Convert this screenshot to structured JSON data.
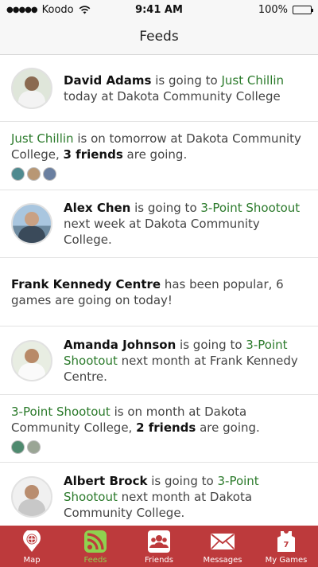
{
  "status": {
    "carrier": "Koodo",
    "time": "9:41 AM",
    "battery": "100%"
  },
  "nav": {
    "title": "Feeds"
  },
  "feed": [
    {
      "name": "David Adams",
      "verb": " is going to ",
      "event": "Just Chillin",
      "rest": " today at Dakota Community College"
    },
    {
      "event": "Just Chillin",
      "mid": " is on tomorrow at Dakota Community College, ",
      "friends": "3 friends",
      "end": " are going."
    },
    {
      "name": "Alex Chen",
      "verb": " is going to ",
      "event": "3-Point Shootout",
      "rest": " next week at Dakota Community College."
    },
    {
      "place": "Frank Kennedy Centre",
      "rest": " has been popular, 6 games are going on today!"
    },
    {
      "name": "Amanda Johnson",
      "verb": " is going to ",
      "event": "3-Point Shootout",
      "rest": " next month at Frank Kennedy Centre."
    },
    {
      "event": "3-Point Shootout",
      "mid": " is on month at Dakota Community College, ",
      "friends": "2 friends",
      "end": " are going."
    },
    {
      "name": "Albert Brock",
      "verb": " is going to ",
      "event": "3-Point Shootout",
      "rest": " next month at Dakota Community College."
    }
  ],
  "tabs": [
    {
      "label": "Map",
      "icon": "basketball-pin-icon"
    },
    {
      "label": "Feeds",
      "icon": "rss-feed-icon"
    },
    {
      "label": "Friends",
      "icon": "friends-icon"
    },
    {
      "label": "Messages",
      "icon": "envelope-icon"
    },
    {
      "label": "My Games",
      "icon": "jersey-icon"
    }
  ],
  "colors": {
    "accent": "#2b7a2b",
    "tabbar": "#bd3a3c",
    "active_tab": "#8fd14f"
  }
}
